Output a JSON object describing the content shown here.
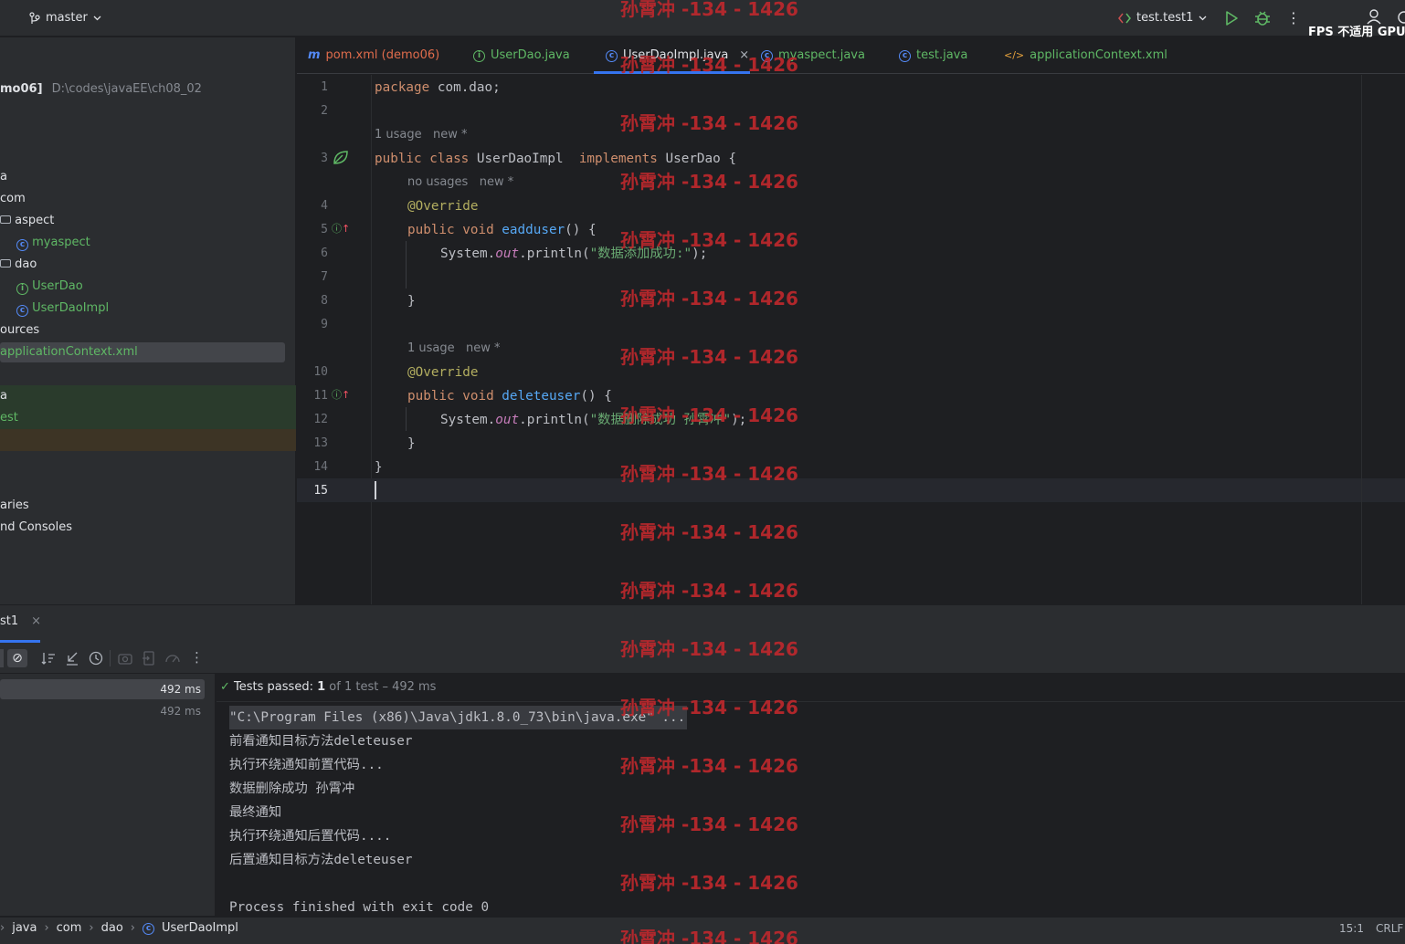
{
  "toolbar": {
    "branch": "master",
    "run_config": "test.test1",
    "fps_label": "FPS 不适用 GPU"
  },
  "project": {
    "root_label": "mo06]",
    "root_path": "D:\\codes\\javaEE\\ch08_02",
    "rows": [
      {
        "label": "a"
      },
      {
        "label": "com"
      },
      {
        "label": "aspect"
      },
      {
        "label": "myaspect"
      },
      {
        "label": "dao"
      },
      {
        "label": "UserDao"
      },
      {
        "label": "UserDaoImpl"
      },
      {
        "label": "ources"
      },
      {
        "label": "applicationContext.xml"
      },
      {
        "label": "a"
      },
      {
        "label": "est"
      },
      {
        "label": "aries"
      },
      {
        "label": "nd Consoles"
      }
    ]
  },
  "tabs": [
    {
      "label": "pom.xml (demo06)",
      "icon": "maven-icon"
    },
    {
      "label": "UserDao.java",
      "icon": "interface-icon"
    },
    {
      "label": "UserDaoImpl.java",
      "icon": "class-icon",
      "active": true
    },
    {
      "label": "myaspect.java",
      "icon": "class-icon"
    },
    {
      "label": "test.java",
      "icon": "class-icon"
    },
    {
      "label": "applicationContext.xml",
      "icon": "xml-icon"
    }
  ],
  "editor": {
    "line_numbers": [
      "1",
      "2",
      "3",
      "4",
      "5",
      "6",
      "7",
      "8",
      "9",
      "10",
      "11",
      "12",
      "13",
      "14",
      "15"
    ],
    "hints": {
      "class_usage": "1 usage",
      "class_new": "new *",
      "m1_usage": "no usages",
      "m1_new": "new *",
      "m2_usage": "1 usage",
      "m2_new": "new *"
    },
    "code": {
      "l1_kw": "package",
      "l1_rest": " com.dao;",
      "l3_kw1": "public class",
      "l3_name": " UserDaoImpl  ",
      "l3_kw2": "implements",
      "l3_rest": " UserDao {",
      "l4_ann": "@Override",
      "l5_kw": "public void",
      "l5_fn": " eadduser",
      "l5_rest": "() {",
      "l6_a": "System.",
      "l6_out": "out",
      "l6_b": ".println(",
      "l6_str": "\"数据添加成功:\"",
      "l6_c": ");",
      "l8": "}",
      "l10_ann": "@Override",
      "l11_kw": "public void",
      "l11_fn": " deleteuser",
      "l11_rest": "() {",
      "l12_a": "System.",
      "l12_out": "out",
      "l12_b": ".println(",
      "l12_str": "\"数据删除成功 孙霄冲\"",
      "l12_c": ");",
      "l13": "}",
      "l14": "}"
    }
  },
  "run": {
    "tab_label": "st1",
    "tree_items": [
      {
        "time": "492 ms"
      },
      {
        "time": "492 ms"
      }
    ],
    "status_prefix": "Tests passed:",
    "status_count": "1",
    "status_rest": "of 1 test – 492 ms",
    "console": [
      "\"C:\\Program Files (x86)\\Java\\jdk1.8.0_73\\bin\\java.exe\" ...",
      "前看通知目标方法deleteuser",
      "执行环绕通知前置代码...",
      "数据删除成功 孙霄冲",
      "最终通知",
      "执行环绕通知后置代码....",
      "后置通知目标方法deleteuser",
      "",
      "Process finished with exit code 0"
    ]
  },
  "statusbar": {
    "crumbs": [
      "java",
      "com",
      "dao",
      "UserDaoImpl"
    ],
    "position": "15:1",
    "line_sep": "CRLF"
  },
  "watermark": "孙霄冲 -134 - 1426",
  "colors": {
    "bg": "#1e1f22",
    "panel": "#2b2d30",
    "accent": "#3574f0",
    "keyword": "#cf8e6d",
    "string": "#6aab73",
    "function": "#56a8f5",
    "watermark": "#c0282d",
    "success": "#5fb865"
  }
}
